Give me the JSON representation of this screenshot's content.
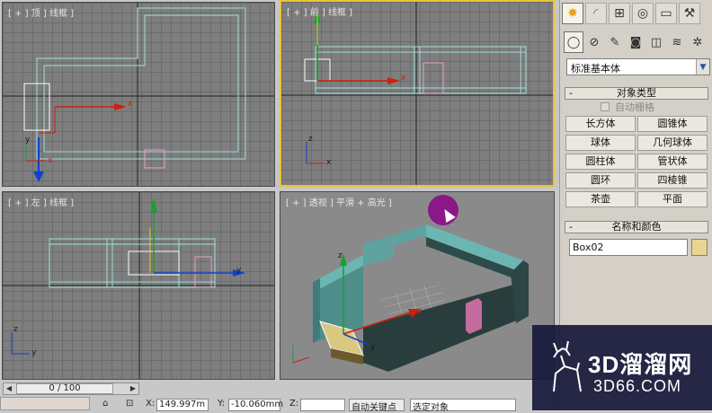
{
  "viewports": {
    "top": {
      "label": "[ + ] 顶 ] 线框 ]"
    },
    "front": {
      "label": "[ + ] 前 ] 线框 ]"
    },
    "left": {
      "label": "[ + ] 左 ] 线框 ]"
    },
    "persp": {
      "label": "[ + ] 透视 ] 平滑 + 高光 ]"
    }
  },
  "axis": {
    "x": "x",
    "y": "y",
    "z": "z"
  },
  "command_panel": {
    "tabs": [
      "create-tab",
      "modify-tab",
      "hierarchy-tab",
      "motion-tab",
      "display-tab",
      "utilities-tab"
    ],
    "subcategories": [
      "geometry",
      "shapes",
      "lights",
      "cameras",
      "helpers",
      "space-warps",
      "systems"
    ],
    "category_dropdown": "标准基本体",
    "object_type": {
      "title": "对象类型",
      "autogrid_label": "自动栅格",
      "buttons": [
        "长方体",
        "圆锥体",
        "球体",
        "几何球体",
        "圆柱体",
        "管状体",
        "圆环",
        "四棱锥",
        "茶壶",
        "平面"
      ]
    },
    "name_color": {
      "title": "名称和颜色",
      "name_value": "Box02",
      "color": "#e8d58f"
    }
  },
  "timeline": {
    "frame_label": "0 / 100"
  },
  "status": {
    "x_label": "X:",
    "x_value": "149.997m",
    "y_label": "Y:",
    "y_value": "-10.060mm",
    "z_label": "Z:",
    "autokey_label": "自动关键点",
    "selection_label": "选定对象"
  },
  "watermark": {
    "text1": "3D溜溜网",
    "text2": "3D66.COM"
  }
}
